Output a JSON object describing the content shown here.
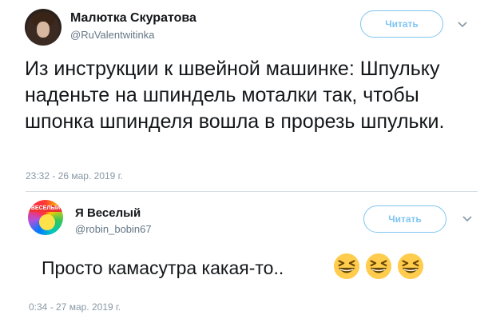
{
  "tweets": [
    {
      "author_name": "Малютка Скуратова",
      "handle": "@RuValentwitinka",
      "follow_label": "Читать",
      "text": "Из инструкции к швейной машинке: Шпульку наденьте на шпиндель моталки так, чтобы шпонка шпинделя вошла в прорезь шпульки.",
      "timestamp": "23:32 - 26 мар. 2019 г."
    },
    {
      "author_name": "Я Веселый",
      "handle": "@robin_bobin67",
      "follow_label": "Читать",
      "avatar_text": "ВЕСЕЛЫЙ",
      "text": "Просто камасутра какая-то..",
      "emojis": [
        "grinning-squinting-face",
        "grinning-squinting-face",
        "grinning-squinting-face"
      ],
      "timestamp": "0:34 - 27 мар. 2019 г."
    }
  ],
  "colors": {
    "follow_button": "#7fc5f2",
    "secondary_text": "#657786",
    "timestamp": "#8899a6",
    "emoji_yellow": "#ffcc4d"
  }
}
